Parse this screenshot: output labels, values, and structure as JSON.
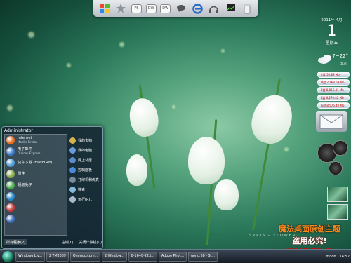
{
  "dock": {
    "items": [
      {
        "name": "windows-logo-icon",
        "kind": "icon"
      },
      {
        "name": "star-icon",
        "kind": "icon"
      },
      {
        "name": "ps-icon",
        "kind": "box",
        "label": "PS"
      },
      {
        "name": "dw-icon",
        "kind": "box",
        "label": "DW"
      },
      {
        "name": "dw2-icon",
        "kind": "box",
        "label": "DW"
      },
      {
        "name": "chat-icon",
        "kind": "icon"
      },
      {
        "name": "ie-icon",
        "kind": "icon"
      },
      {
        "name": "headphones-icon",
        "kind": "icon"
      },
      {
        "name": "monitor-icon",
        "kind": "icon"
      },
      {
        "name": "trash-icon",
        "kind": "icon"
      }
    ]
  },
  "calendar": {
    "year_month": "2011年 4月",
    "day": "1",
    "weekday": "星期五"
  },
  "weather": {
    "temp": "7~22°",
    "city": "北京"
  },
  "sensors": [
    "C盘 50.89 Mb",
    "D盘 2,168.69 Mb",
    "E盘 8,856.41 Mb",
    "F盘 6,270.42 Mb",
    "G盘 8,576.40 Mb"
  ],
  "start_menu": {
    "user": "Administrator",
    "left_items": [
      {
        "label": "Internet",
        "sub": "Mozilla Firefox",
        "color": "#e66a1a"
      },
      {
        "label": "电子邮件",
        "sub": "Outlook Express",
        "color": "#3a78c8"
      },
      {
        "label": "快车下载 (FlashGet)",
        "sub": "",
        "color": "#4a9ad8"
      },
      {
        "label": "附件",
        "sub": "",
        "color": "#88aa44"
      },
      {
        "label": "超级兔子",
        "sub": "",
        "color": "#4aa84a"
      },
      {
        "label": "",
        "sub": "",
        "color": "#2a88c8"
      },
      {
        "label": "",
        "sub": "",
        "color": "#c83a3a"
      },
      {
        "label": "",
        "sub": "",
        "color": "#3a6ab8"
      }
    ],
    "right_items": [
      {
        "label": "我的文档",
        "color": "#d8b24a"
      },
      {
        "label": "我的电脑",
        "color": "#6a9ad8"
      },
      {
        "label": "网上邻居",
        "color": "#5a8ac8"
      },
      {
        "label": "控制面板",
        "color": "#4a8ad8"
      },
      {
        "label": "打印机和传真",
        "color": "#7a8a9a"
      },
      {
        "label": "搜索",
        "color": "#8ab8d8"
      },
      {
        "label": "运行(R)...",
        "color": "#aab8c8"
      }
    ],
    "all_programs": "所有程序(P)",
    "logoff": "注销(L)",
    "shutdown": "关闭计算机(U)"
  },
  "wallpaper": {
    "title": "SPRING  FLOWER"
  },
  "brand": {
    "line1": "魔法桌面原创主题",
    "line2": "盗用必究!",
    "line3": "www.ommoo.com"
  },
  "taskbar": {
    "items": [
      "Windows Liv...",
      "2 TM2009",
      "Ommoo.com...",
      "2 Window...",
      "8-16--8-22.t...",
      "Adobe Phot...",
      "gong.58 - St..."
    ],
    "tray_label": "moon",
    "time": "14:52"
  }
}
